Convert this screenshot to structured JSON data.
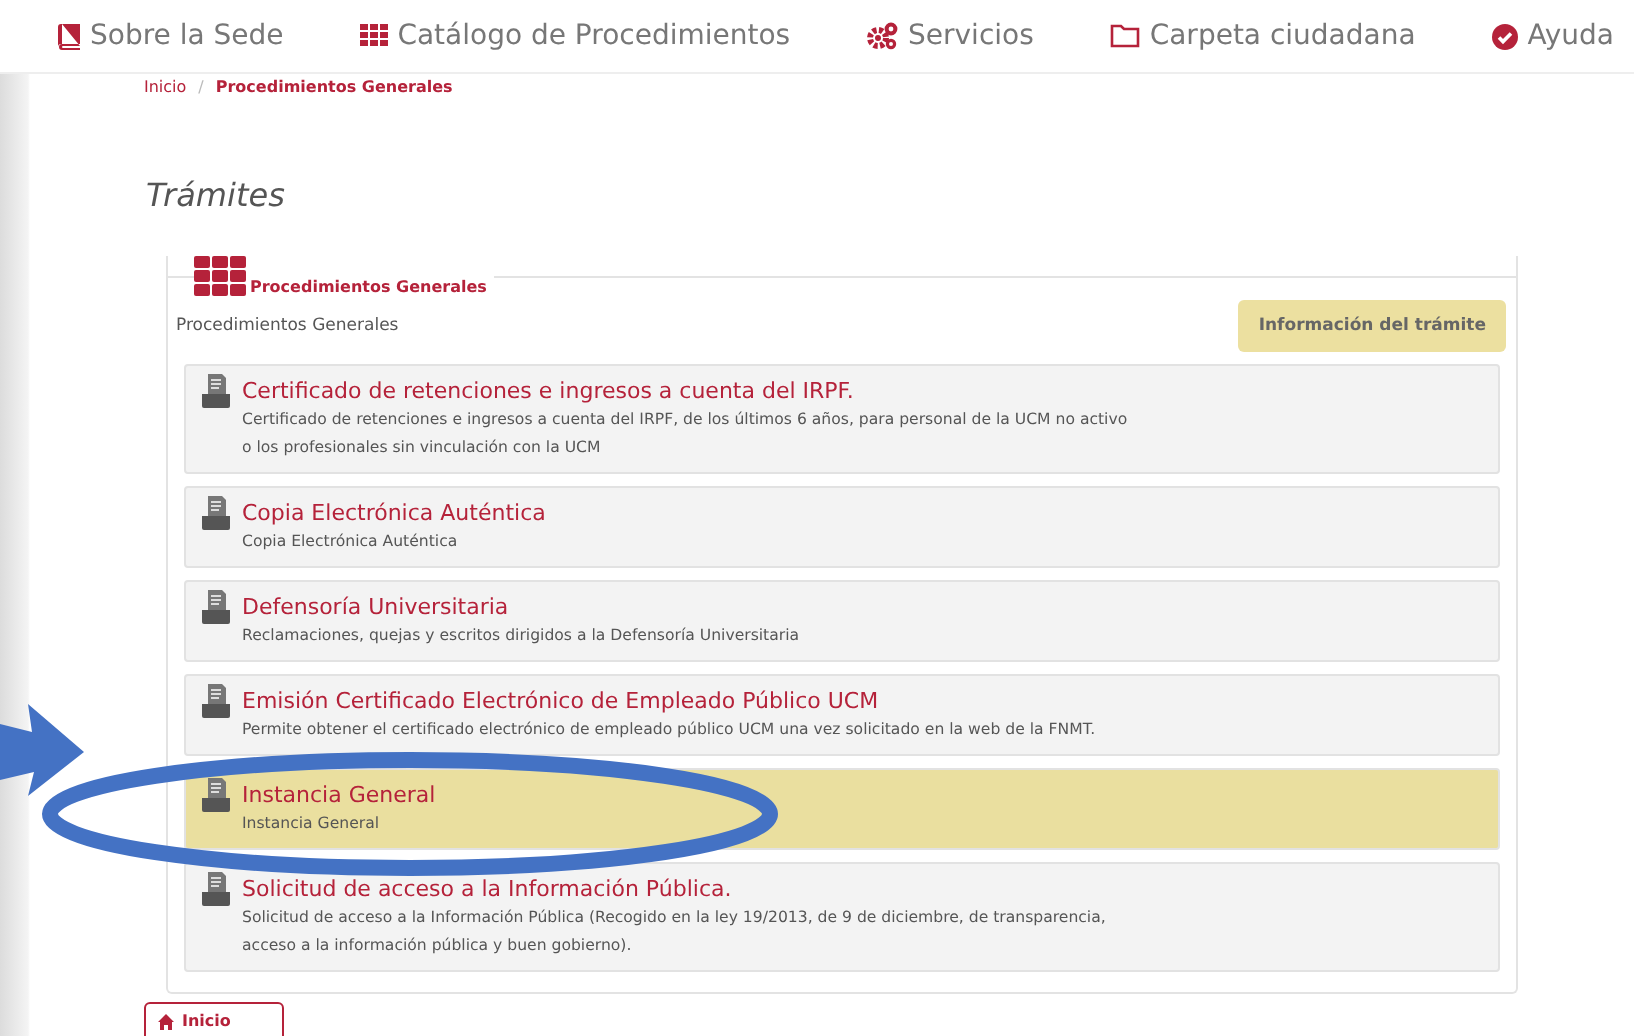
{
  "nav": [
    {
      "label": "Sobre la Sede"
    },
    {
      "label": "Catálogo de Procedimientos"
    },
    {
      "label": "Servicios"
    },
    {
      "label": "Carpeta ciudadana"
    },
    {
      "label": "Ayuda"
    }
  ],
  "breadcrumb": [
    {
      "label": "Inicio",
      "current": false
    },
    {
      "label": "Procedimientos Generales",
      "current": true
    }
  ],
  "breadcrumb_separator": "/",
  "heading": "Trámites",
  "group": {
    "legend": "Procedimientos Generales",
    "label": "Procedimientos Generales",
    "info_button": "Información del trámite",
    "items": [
      {
        "title": "Certificado de retenciones e ingresos a cuenta del IRPF.",
        "description": [
          "Certificado de retenciones e ingresos a cuenta del IRPF, de los últimos 6 años, para personal de la UCM no activo",
          "o los profesionales sin vinculación con la UCM"
        ],
        "selected": false
      },
      {
        "title": "Copia Electrónica Auténtica",
        "description": [
          "Copia Electrónica Auténtica"
        ],
        "selected": false
      },
      {
        "title": "Defensoría Universitaria",
        "description": [
          "Reclamaciones, quejas y escritos dirigidos a la Defensoría Universitaria"
        ],
        "selected": false
      },
      {
        "title": "Emisión Certificado Electrónico de Empleado Público UCM",
        "description": [
          "Permite obtener el certificado electrónico de empleado público UCM una vez solicitado en la web de la FNMT."
        ],
        "selected": false
      },
      {
        "title": "Instancia General",
        "description": [
          "Instancia General"
        ],
        "selected": true
      },
      {
        "title": "Solicitud de acceso a la Información Pública.",
        "description": [
          "Solicitud de acceso a la Información Pública (Recogido en la ley 19/2013, de 9 de diciembre, de transparencia,",
          "acceso a la información pública y buen gobierno)."
        ],
        "selected": false
      }
    ]
  },
  "home_button": "Inicio"
}
